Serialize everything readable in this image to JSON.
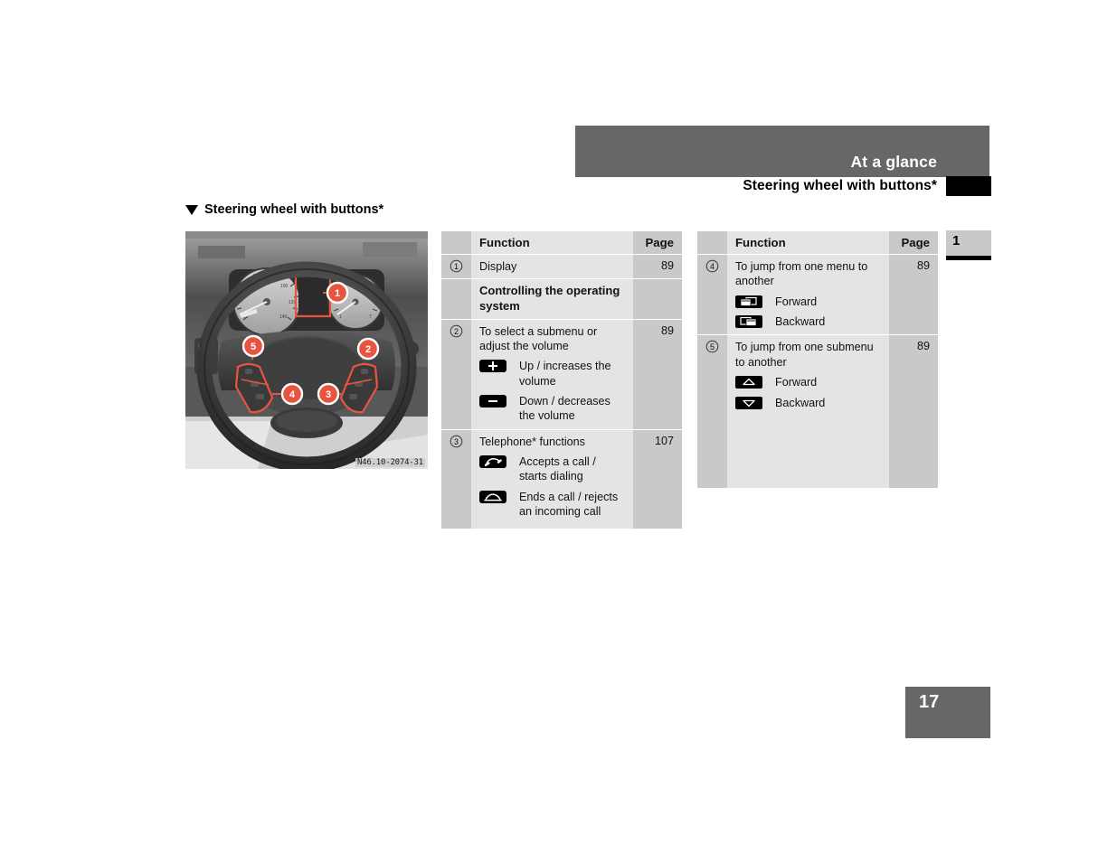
{
  "header": {
    "chapter_title": "At a glance",
    "section_title": "Steering wheel with buttons*",
    "chapter_number": "1",
    "page_number": "17"
  },
  "section": {
    "heading": "Steering wheel with buttons*",
    "marker_icon": "triangle-down-icon"
  },
  "figure": {
    "caption_code": "N46.10-2074-31",
    "alt": "Steering wheel with multifunction buttons, callouts 1 to 5",
    "callouts": [
      "1",
      "2",
      "3",
      "4",
      "5"
    ]
  },
  "tables": {
    "left": {
      "columns": [
        "",
        "Function",
        "Page"
      ],
      "rows": [
        {
          "num": "1",
          "num_icon": "circled-number-1",
          "function": "Display",
          "page": "89",
          "subitems": []
        },
        {
          "num": "",
          "function": "Controlling the operating system",
          "bold": true,
          "page": "",
          "subitems": []
        },
        {
          "num": "2",
          "num_icon": "circled-number-2",
          "function": "To select a submenu or adjust the volume",
          "page": "89",
          "subitems": [
            {
              "icon": "plus-button-icon",
              "label": "Up / increases the volume"
            },
            {
              "icon": "minus-button-icon",
              "label": "Down / decreases the volume"
            }
          ]
        },
        {
          "num": "3",
          "num_icon": "circled-number-3",
          "function": "Telephone* functions",
          "page": "107",
          "subitems": [
            {
              "icon": "phone-pickup-icon",
              "label": "Accepts a call / starts dialing"
            },
            {
              "icon": "phone-hangup-icon",
              "label": "Ends a call / rejects an incoming call"
            }
          ]
        }
      ]
    },
    "right": {
      "columns": [
        "",
        "Function",
        "Page"
      ],
      "rows": [
        {
          "num": "4",
          "num_icon": "circled-number-4",
          "function": "To jump from one menu to another",
          "page": "89",
          "subitems": [
            {
              "icon": "window-forward-icon",
              "label": "Forward"
            },
            {
              "icon": "window-backward-icon",
              "label": "Backward"
            }
          ]
        },
        {
          "num": "5",
          "num_icon": "circled-number-5",
          "function": "To jump from one submenu to another",
          "page": "89",
          "subitems": [
            {
              "icon": "triangle-up-icon",
              "label": "Forward"
            },
            {
              "icon": "triangle-down-icon",
              "label": "Backward"
            }
          ]
        }
      ]
    }
  },
  "colors": {
    "header_band": "#676767",
    "table_num_col": "#c9c9c9",
    "table_fn_col": "#e4e4e4",
    "callout_red": "#e8543f",
    "page_box": "#676767"
  }
}
